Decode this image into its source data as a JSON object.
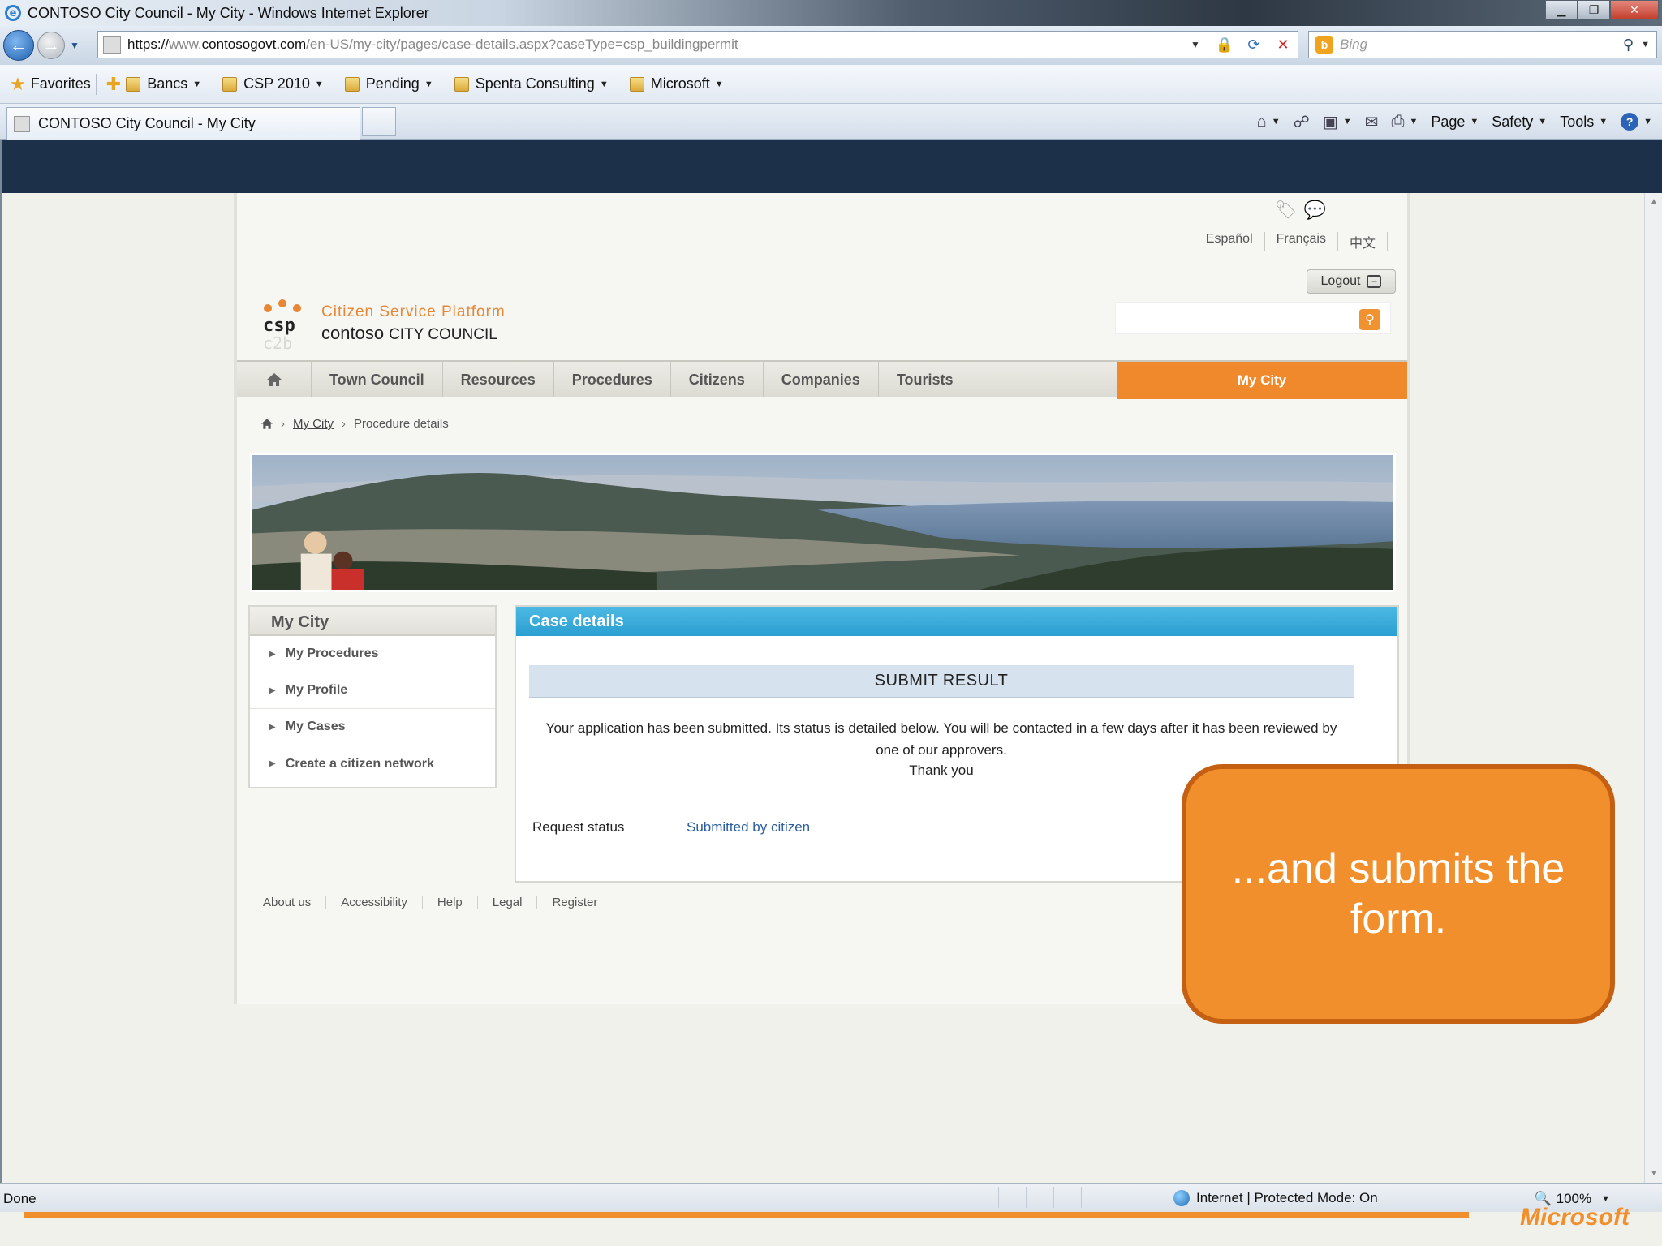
{
  "browser": {
    "window_title": "CONTOSO City Council - My City - Windows Internet Explorer",
    "url_scheme": "https://",
    "url_www": "www.",
    "url_domain": "contosogovt.com",
    "url_path": "/en-US/my-city/pages/case-details.aspx?caseType=csp_buildingpermit",
    "search_placeholder": "Bing",
    "favorites_label": "Favorites",
    "favorites_folders": [
      "Bancs",
      "CSP 2010",
      "Pending",
      "Spenta Consulting",
      "Microsoft"
    ],
    "tab_title": "CONTOSO City Council - My City",
    "commands": [
      "Page",
      "Safety",
      "Tools"
    ],
    "status_left": "Done",
    "status_zone": "Internet | Protected Mode: On",
    "zoom": "100%"
  },
  "site": {
    "languages": [
      "Español",
      "Français",
      "中文"
    ],
    "logout_label": "Logout",
    "brand_tagline": "Citizen Service Platform",
    "brand_name": "contoso",
    "brand_suffix": "CITY COUNCIL",
    "logo_text_top": "csp",
    "logo_text_bottom": "c2b",
    "nav_items": [
      "Town Council",
      "Resources",
      "Procedures",
      "Citizens",
      "Companies",
      "Tourists"
    ],
    "nav_active": "My City",
    "breadcrumb": {
      "link": "My City",
      "current": "Procedure details"
    }
  },
  "sidebar": {
    "title": "My City",
    "items": [
      "My Procedures",
      "My Profile",
      "My Cases",
      "Create a citizen network"
    ]
  },
  "case": {
    "header": "Case details",
    "result_title": "SUBMIT RESULT",
    "message": "Your application has been submitted. Its status is detailed below. You will be contacted in a few days after it has been reviewed by one of our approvers.",
    "thanks": "Thank you",
    "status_label": "Request status",
    "status_value": "Submitted by citizen"
  },
  "footer": [
    "About us",
    "Accessibility",
    "Help",
    "Legal",
    "Register"
  ],
  "callout": {
    "text": "...and submits the form."
  },
  "slide_logo": "Microsoft",
  "colors": {
    "accent_orange": "#f0892b",
    "header_navy": "#1c3049",
    "case_header_blue": "#2a9fd1",
    "status_link": "#2b5fa0"
  }
}
